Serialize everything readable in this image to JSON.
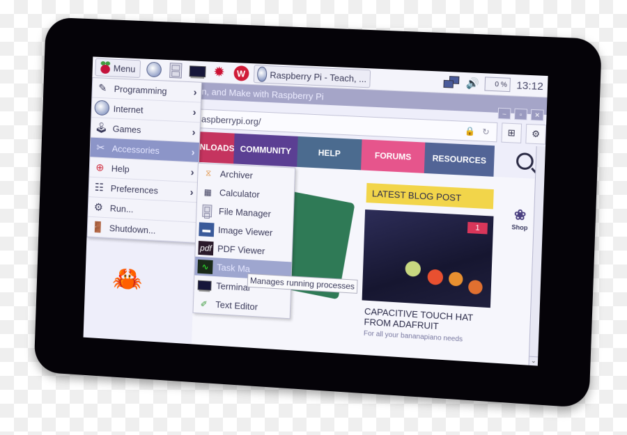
{
  "taskbar": {
    "menu_label": "Menu",
    "launchers": [
      "web-browser",
      "file-manager",
      "terminal",
      "mathematica",
      "wolfram"
    ],
    "task_title": "Raspberry Pi - Teach, ...",
    "cpu_usage": "0 %",
    "clock": "13:12"
  },
  "browser": {
    "title": "n, and Make with Raspberry Pi",
    "url": "aspberrypi.org/",
    "window_buttons": [
      "minimize",
      "maximize",
      "close"
    ],
    "nav": [
      "NLOADS",
      "COMMUNITY",
      "HELP",
      "FORUMS",
      "RESOURCES"
    ],
    "nav_colors": {
      "downloads": "#c5345f",
      "community": "#5b3f93",
      "help": "#4b6b8f",
      "forums": "#e6558c",
      "resources": "#526496"
    },
    "blog": {
      "label": "LATEST BLOG POST",
      "badge": "1",
      "title": "CAPACITIVE TOUCH HAT FROM ADAFRUIT",
      "subtitle": "For all your bananapiano needs"
    },
    "shop_label": "Shop"
  },
  "main_menu": {
    "items": [
      {
        "label": "Programming",
        "submenu": true
      },
      {
        "label": "Internet",
        "submenu": true
      },
      {
        "label": "Games",
        "submenu": true
      },
      {
        "label": "Accessories",
        "submenu": true,
        "selected": true
      },
      {
        "label": "Help",
        "submenu": true
      },
      {
        "label": "Preferences",
        "submenu": true
      },
      {
        "label": "Run...",
        "submenu": false
      },
      {
        "label": "Shutdown...",
        "submenu": false
      }
    ]
  },
  "accessories_menu": {
    "items": [
      {
        "label": "Archiver"
      },
      {
        "label": "Calculator"
      },
      {
        "label": "File Manager"
      },
      {
        "label": "Image Viewer"
      },
      {
        "label": "PDF Viewer"
      },
      {
        "label": "Task Ma",
        "selected": true
      },
      {
        "label": "Terminal"
      },
      {
        "label": "Text Editor"
      }
    ]
  },
  "tooltip": "Manages running processes",
  "arrow_glyph": "›"
}
